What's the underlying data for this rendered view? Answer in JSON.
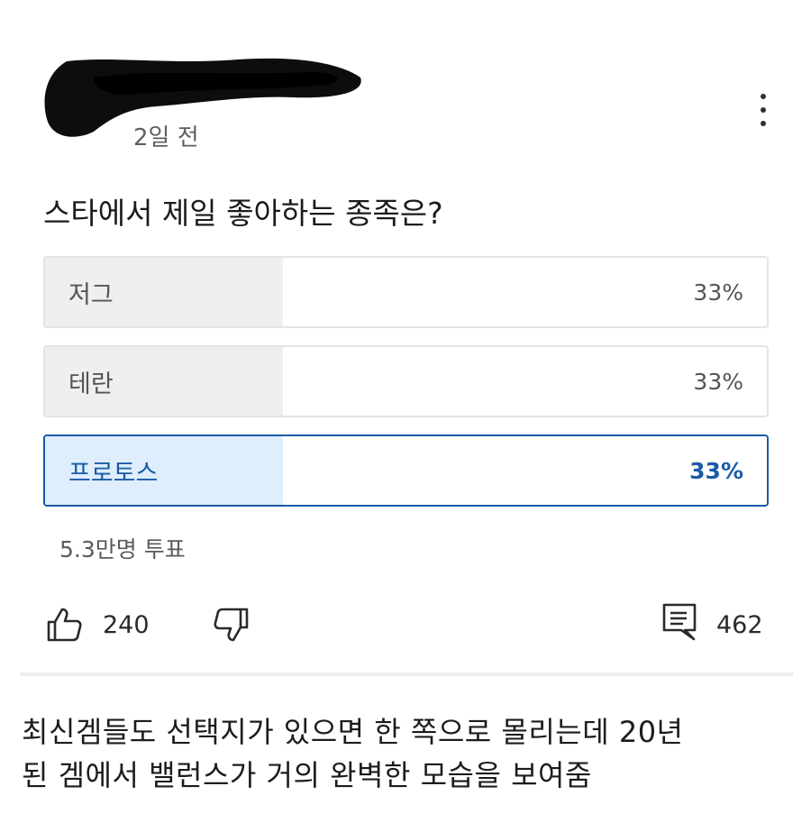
{
  "post": {
    "timestamp": "2일 전",
    "question": "스타에서 제일 좋아하는 종족은?",
    "options": [
      {
        "label": "저그",
        "percent_text": "33%",
        "fill_fraction": 0.33,
        "selected": false
      },
      {
        "label": "테란",
        "percent_text": "33%",
        "fill_fraction": 0.33,
        "selected": false
      },
      {
        "label": "프로토스",
        "percent_text": "33%",
        "fill_fraction": 0.33,
        "selected": true
      }
    ],
    "vote_count": "5.3만명 투표",
    "actions": {
      "like_count": "240",
      "comment_count": "462"
    },
    "icons": {
      "menu": "more-vert-icon",
      "like": "thumb-up-icon",
      "dislike": "thumb-down-icon",
      "comments": "comment-icon"
    }
  },
  "caption": {
    "line1": "최신겜들도 선택지가 있으면 한 쪽으로 몰리는데 20년",
    "line2": "된 겜에서 밸런스가 거의 완벽한 모습을 보여줌"
  },
  "colors": {
    "selected_accent": "#1a5ba7",
    "selected_fill": "#dfeefc",
    "unselected_fill": "#efefef"
  }
}
